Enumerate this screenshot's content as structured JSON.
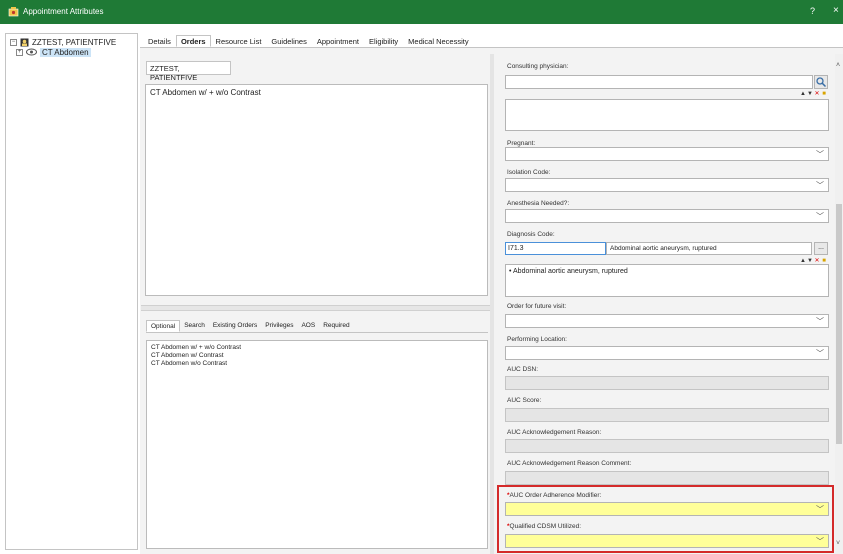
{
  "window": {
    "title": "Appointment Attributes",
    "help": "?",
    "close": "×"
  },
  "tree": {
    "patient": "ZZTEST, PATIENTFIVE",
    "order": "CT Abdomen",
    "toggle_expanded": "−",
    "toggle_collapsed": "+"
  },
  "tabs": [
    "Details",
    "Orders",
    "Resource List",
    "Guidelines",
    "Appointment",
    "Eligibility",
    "Medical Necessity"
  ],
  "orders": {
    "patient_name": "ZZTEST, PATIENTFIVE",
    "items": [
      "CT Abdomen w/ + w/o Contrast"
    ]
  },
  "subtabs": [
    "Optional",
    "Search",
    "Existing Orders",
    "Privileges",
    "AOS",
    "Required"
  ],
  "search_results": [
    "CT Abdomen w/ + w/o Contrast",
    "CT Abdomen w/ Contrast",
    "CT Abdomen w/o Contrast"
  ],
  "form": {
    "consulting_physician": "Consulting physician:",
    "pregnant": "Pregnant:",
    "isolation_code": "Isolation Code:",
    "anesthesia_needed": "Anesthesia Needed?:",
    "diagnosis_code": "Diagnosis Code:",
    "diagnosis_code_value": "I71.3",
    "diagnosis_description": "Abdominal aortic aneurysm, ruptured",
    "diagnosis_bullet": "• Abdominal aortic aneurysm, ruptured",
    "diagnosis_lookup": "...",
    "order_future_visit": "Order for future visit:",
    "performing_location": "Performing Location:",
    "auc_dsn": "AUC DSN:",
    "auc_score": "AUC Score:",
    "auc_ack_reason": "AUC Acknowledgement Reason:",
    "auc_ack_reason_comment": "AUC Acknowledgement Reason Comment:",
    "auc_adherence_modifier": "AUC Order Adherence Modifier:",
    "qualified_cdsm": "Qualified CDSM Utilized:",
    "required_marker": "*"
  },
  "colors": {
    "titlebar": "#1f7a36",
    "highlight_border": "#d42a2a",
    "required_field_bg": "#ffff99"
  }
}
